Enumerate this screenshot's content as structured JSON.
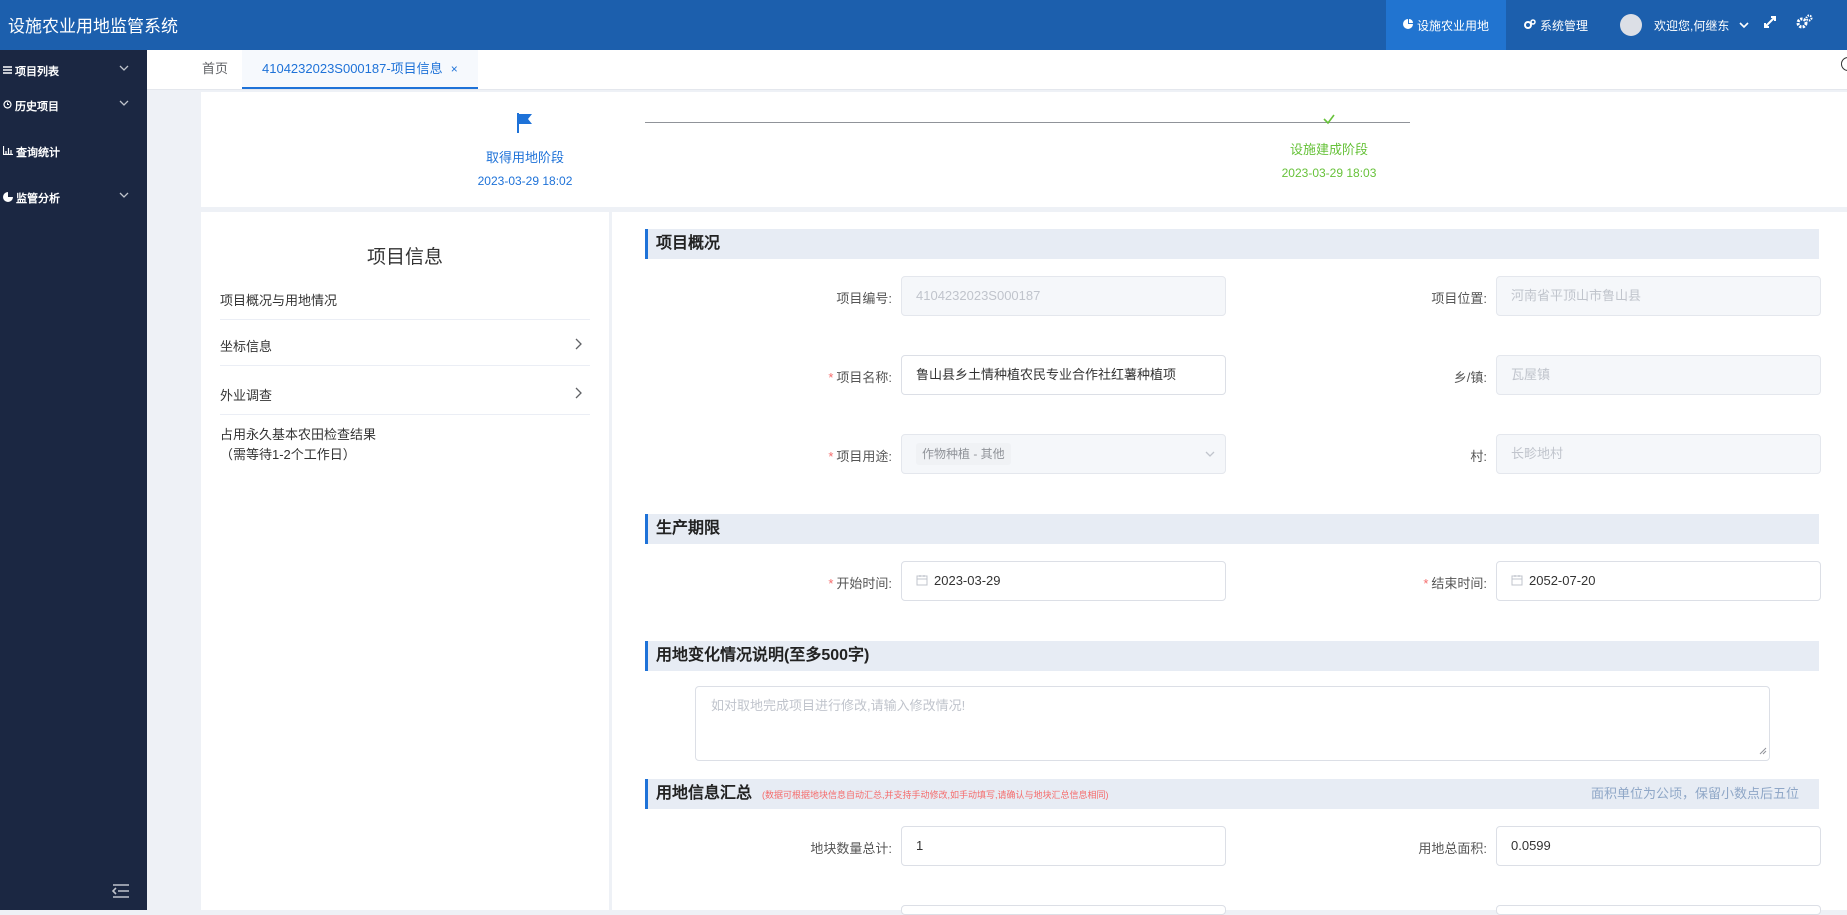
{
  "header": {
    "app_title": "设施农业用地监管系统",
    "nav_land": "设施农业用地",
    "nav_system": "系统管理",
    "user_greeting": "欢迎您,何继东"
  },
  "sidebar": {
    "items": [
      {
        "label": "项目列表"
      },
      {
        "label": "历史项目"
      },
      {
        "label": "查询统计"
      },
      {
        "label": "监管分析"
      }
    ]
  },
  "tabs": {
    "home": "首页",
    "project": "4104232023S000187-项目信息",
    "close": "×"
  },
  "steps": [
    {
      "label": "取得用地阶段",
      "time": "2023-03-29 18:02"
    },
    {
      "label": "设施建成阶段",
      "time": "2023-03-29 18:03"
    }
  ],
  "left_panel": {
    "title": "项目信息",
    "items": [
      {
        "label": "项目概况与用地情况"
      },
      {
        "label": "坐标信息"
      },
      {
        "label": "外业调查"
      },
      {
        "label": "占用永久基本农田检查结果",
        "sub": "（需等待1-2个工作日）"
      }
    ]
  },
  "overview": {
    "title": "项目概况",
    "project_no_label": "项目编号:",
    "project_no": "4104232023S000187",
    "location_label": "项目位置:",
    "location": "河南省平顶山市鲁山县",
    "name_label": "项目名称:",
    "name": "鲁山县乡土情种植农民专业合作社红薯种植项",
    "town_label": "乡/镇:",
    "town": "瓦屋镇",
    "usage_label": "项目用途:",
    "usage": "作物种植 - 其他",
    "village_label": "村:",
    "village": "长畛地村"
  },
  "period": {
    "title": "生产期限",
    "start_label": "开始时间:",
    "start": "2023-03-29",
    "end_label": "结束时间:",
    "end": "2052-07-20"
  },
  "change": {
    "title": "用地变化情况说明(至多500字)",
    "placeholder": "如对取地完成项目进行修改,请输入修改情况!"
  },
  "summary": {
    "title": "用地信息汇总",
    "note": "(数据可根据地块信息自动汇总,并支持手动修改,如手动填写,请确认与地块汇总信息相同)",
    "unit": "面积单位为公顷，保留小数点后五位",
    "count_label": "地块数量总计:",
    "count": "1",
    "area_label": "用地总面积:",
    "area": "0.0599"
  },
  "colors": {
    "header": "#1c5fad",
    "sidebar": "#1b2742",
    "primary": "#1e72d8",
    "success": "#67c23a",
    "required": "#f56c6c"
  }
}
